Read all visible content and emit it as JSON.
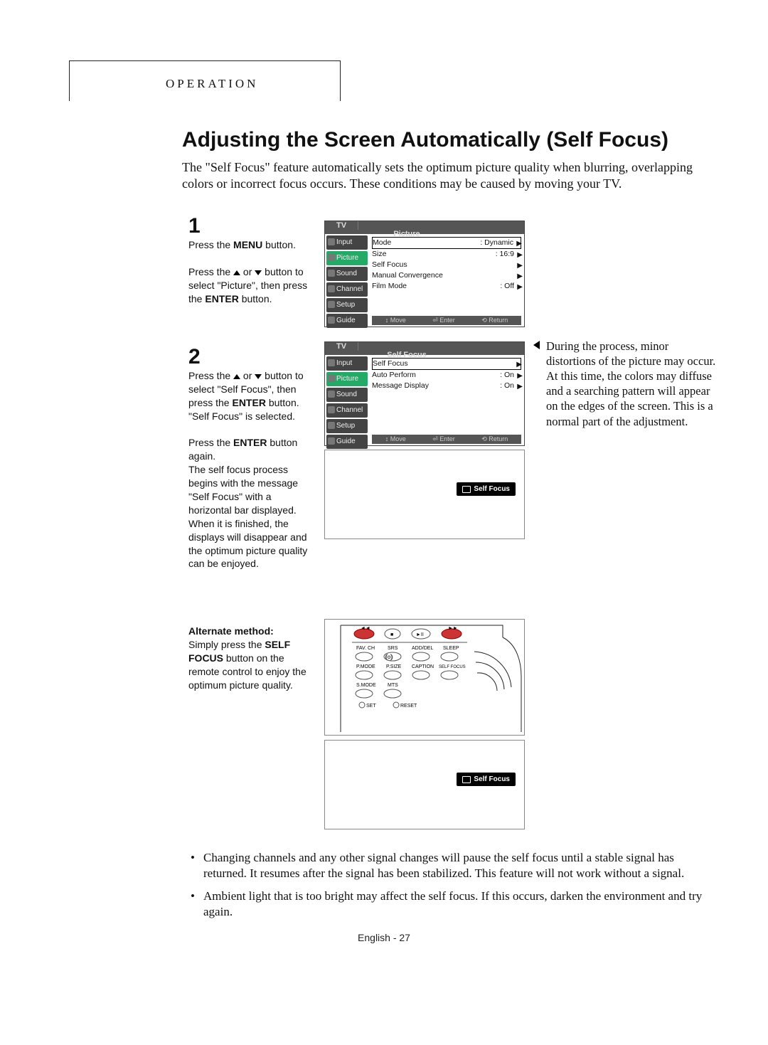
{
  "header": {
    "section_label": "OPERATION"
  },
  "title": "Adjusting the Screen Automatically (Self Focus)",
  "intro": "The \"Self Focus\" feature automatically sets the optimum picture quality when blurring, overlapping colors or incorrect focus occurs. These conditions may be caused by moving your TV.",
  "step1": {
    "num": "1",
    "line1a": "Press the ",
    "line1b": "MENU",
    "line1c": " button.",
    "line2a": "Press the ",
    "line2b": " or ",
    "line2c": " button to select \"Picture\", then press the ",
    "line2d": "ENTER",
    "line2e": " button."
  },
  "step2": {
    "num": "2",
    "p1a": "Press the ",
    "p1b": " or ",
    "p1c": " button to select \"Self Focus\", then press the ",
    "p1d": "ENTER",
    "p1e": " button. \"Self Focus\" is selected.",
    "p2a": "Press the ",
    "p2b": "ENTER",
    "p2c": " button again.",
    "p3": "The self focus process begins with the message \"Self Focus\" with a horizontal bar displayed. When it is finished, the displays will disappear and the optimum picture quality can be enjoyed."
  },
  "alt": {
    "head": "Alternate method:",
    "a": "Simply press the ",
    "b": "SELF FOCUS",
    "c": " button on the remote control to enjoy the optimum picture quality."
  },
  "osd1": {
    "tv": "TV",
    "title": "Picture",
    "tabs": [
      "Input",
      "Picture",
      "Sound",
      "Channel",
      "Setup",
      "Guide"
    ],
    "rows": [
      {
        "l": "Mode",
        "r": ": Dynamic",
        "sel": true
      },
      {
        "l": "Size",
        "r": ": 16:9"
      },
      {
        "l": "Self Focus",
        "r": ""
      },
      {
        "l": "Manual Convergence",
        "r": ""
      },
      {
        "l": "Film Mode",
        "r": ": Off"
      }
    ],
    "footer": {
      "move": "Move",
      "enter": "Enter",
      "return": "Return"
    }
  },
  "osd2": {
    "tv": "TV",
    "title": "Self Focus",
    "tabs": [
      "Input",
      "Picture",
      "Sound",
      "Channel",
      "Setup",
      "Guide"
    ],
    "rows": [
      {
        "l": "Self Focus",
        "r": "",
        "sel": true
      },
      {
        "l": "Auto Perform",
        "r": ": On"
      },
      {
        "l": "Message Display",
        "r": ": On"
      }
    ],
    "footer": {
      "move": "Move",
      "enter": "Enter",
      "return": "Return"
    }
  },
  "sfbadge": "Self Focus",
  "sidenote": "During the process, minor distortions of the picture may occur. At this time, the colors may diffuse and a searching pattern will appear on the edges of the screen. This is a normal part of the adjustment.",
  "remote": {
    "row2": [
      "FAV. CH",
      "SRS",
      "ADD/DEL",
      "SLEEP"
    ],
    "row3": [
      "P.MODE",
      "P.SIZE",
      "CAPTION",
      "SELF FOCUS"
    ],
    "row4": [
      "S.MODE",
      "MTS"
    ],
    "row5": [
      "SET",
      "RESET"
    ]
  },
  "bullets": [
    "Changing channels and any other signal changes will pause the self focus until a stable signal has returned. It resumes after the signal has been stabilized. This feature will not work without a signal.",
    "Ambient light that is too bright may affect the self focus. If this occurs, darken the environment and try again."
  ],
  "pagenum": "English - 27"
}
